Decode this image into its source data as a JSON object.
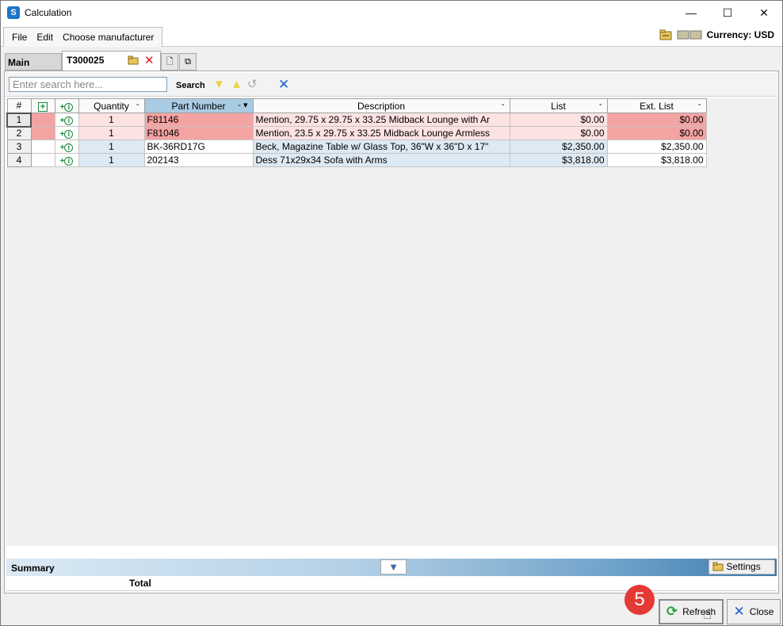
{
  "window": {
    "title": "Calculation",
    "minimize": "—",
    "maximize": "☐",
    "close": "✕"
  },
  "menu": {
    "items": [
      "File",
      "Edit",
      "Choose manufacturer"
    ],
    "currency_label": "Currency: USD"
  },
  "tabs": {
    "main": "Main",
    "doc": "T300025"
  },
  "search": {
    "placeholder": "Enter search here...",
    "label": "Search"
  },
  "grid": {
    "columns": {
      "num": "#",
      "quantity": "Quantity",
      "part_number": "Part Number",
      "description": "Description",
      "list": "List",
      "ext_list": "Ext. List"
    },
    "rows": [
      {
        "num": "1",
        "quantity": "1",
        "part": "F81146",
        "description": "Mention, 29.75 x 29.75 x 33.25 Midback Lounge with Ar",
        "list": "$0.00",
        "ext": "$0.00"
      },
      {
        "num": "2",
        "quantity": "1",
        "part": "F81046",
        "description": "Mention, 23.5 x 29.75 x 33.25 Midback Lounge Armless",
        "list": "$0.00",
        "ext": "$0.00"
      },
      {
        "num": "3",
        "quantity": "1",
        "part": "BK-36RD17G",
        "description": "Beck, Magazine Table w/ Glass Top, 36\"W x 36\"D x 17\"",
        "list": "$2,350.00",
        "ext": "$2,350.00"
      },
      {
        "num": "4",
        "quantity": "1",
        "part": "202143",
        "description": "Dess 71x29x34 Sofa with Arms",
        "list": "$3,818.00",
        "ext": "$3,818.00"
      }
    ]
  },
  "summary": {
    "label": "Summary",
    "settings": "Settings",
    "total": "Total"
  },
  "buttons": {
    "refresh": "Refresh",
    "close": "Close"
  },
  "badge": "5",
  "colors": {
    "row_error": "#f4a3a3",
    "row_error_light": "#fde2e2",
    "row_stripe": "#dde9f3",
    "sorted_header": "#a9cbe3",
    "badge": "#e53935"
  }
}
